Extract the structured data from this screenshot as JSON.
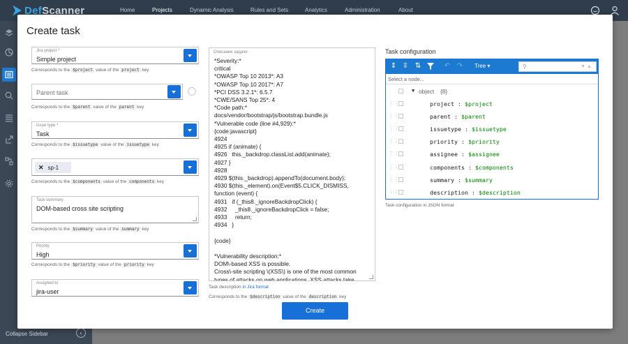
{
  "app": {
    "logo_prefix": "D",
    "logo_rest": "ef",
    "logo_suffix": "Scanner"
  },
  "nav": {
    "items": [
      "Home",
      "Projects",
      "Dynamic Analysis",
      "Rules and Sets",
      "Analytics",
      "Administration",
      "About"
    ],
    "active": "Projects"
  },
  "sidebar": {
    "collapse_label": "Collapse Sidebar"
  },
  "modal": {
    "title": "Create task",
    "fields": {
      "project": {
        "label": "Jira project *",
        "value": "Simple project",
        "hint_pre": "Corresponds to the",
        "var": "$project",
        "hint_mid": "value of the",
        "key": "project",
        "hint_post": "key"
      },
      "parent": {
        "placeholder": "Parent task",
        "hint_pre": "Corresponds to the",
        "var": "$parent",
        "hint_mid": "value of the",
        "key": "parent",
        "hint_post": "key"
      },
      "issuetype": {
        "label": "Issue type *",
        "value": "Task",
        "hint_pre": "Corresponds to the",
        "var": "$issuetype",
        "hint_mid": "value of the",
        "key": "issuetype",
        "hint_post": "key"
      },
      "components": {
        "chip": "sp-1",
        "hint_pre": "Corresponds to the",
        "var": "$components",
        "hint_mid": "value of the",
        "key": "components",
        "hint_post": "key"
      },
      "summary": {
        "label": "Task summary",
        "value": "DOM-based cross site scripting",
        "hint_pre": "Corresponds to the",
        "var": "$summary",
        "hint_mid": "value of the",
        "key": "summary",
        "hint_post": "key"
      },
      "priority": {
        "label": "Priority",
        "value": "High",
        "hint_pre": "Corresponds to the",
        "var": "$priority",
        "hint_mid": "value of the",
        "key": "priority",
        "hint_post": "key"
      },
      "assigned": {
        "label": "Assigned to",
        "value": "jira-user"
      }
    },
    "description": {
      "label": "Описание задачи",
      "text": "*Severity:*\ncritical\n*OWASP Top 10 2013*: A3\n*OWASP Top 10 2017*: A7\n*PCI DSS 3.2.1*: 6.5.7\n*CWE/SANS Top 25*: 4\n*Code path:*\ndocs/vendor/bootstrap/js/bootstrap.bundle.js\n*Vulnerable code (line #4,929):*\n{code:javascript}\n4924\n4925 if (animate) {\n4926   this._backdrop.classList.add(animate);\n4927 }\n4928\n4929 $(this._backdrop).appendTo(document.body);\n4930 $(this._element).on(Event$5.CLICK_DISMISS,\nfunction (event) {\n4931   if (_this8._ignoreBackdropClick) {\n4932     _this8._ignoreBackdropClick = false;\n4933     return;\n4934   }\n\n{code}\n\n*Vulnerability description:*\nDOM\\-based XSS is possible.\nCross\\-site scripting \\(XSS\\) is one of the most common\ntypes of attacks on web applications. XSS attacks take",
      "hint_pre": "Task description",
      "hint_link": "in Jira format",
      "hint2_pre": "Corresponds to the",
      "hint2_var": "$description",
      "hint2_mid": "value of the",
      "hint2_key": "description",
      "hint2_post": "key"
    },
    "config": {
      "title": "Task configuration",
      "mode": "Tree ▾",
      "nav_placeholder": "Select a node...",
      "root_key": "object",
      "root_count": "{8}",
      "rows": [
        {
          "key": "project",
          "value": "$project"
        },
        {
          "key": "parent",
          "value": "$parent"
        },
        {
          "key": "issuetype",
          "value": "$issuetype"
        },
        {
          "key": "priority",
          "value": "$priority"
        },
        {
          "key": "assignee",
          "value": "$assignee"
        },
        {
          "key": "components",
          "value": "$components"
        },
        {
          "key": "summary",
          "value": "$summary"
        },
        {
          "key": "description",
          "value": "$description"
        }
      ],
      "hint": "Task configuration in JSON format"
    },
    "create_label": "Create"
  },
  "colors": {
    "accent": "#1670d8",
    "topbar": "#2f3d4c",
    "sidebar": "#3b4754",
    "json_value": "#008000"
  }
}
